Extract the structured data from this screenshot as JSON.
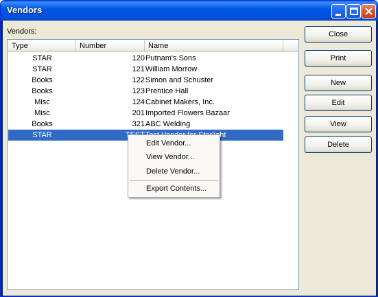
{
  "window": {
    "title": "Vendors",
    "controls": {
      "minimize": "minimize-icon",
      "maximize": "maximize-icon",
      "close": "close-icon"
    }
  },
  "list_label": "Vendors:",
  "columns": [
    "Type",
    "Number",
    "Name"
  ],
  "rows": [
    {
      "type": "STAR",
      "number": "120",
      "name": "Putnam's Sons"
    },
    {
      "type": "STAR",
      "number": "121",
      "name": "William Morrow"
    },
    {
      "type": "Books",
      "number": "122",
      "name": "Simon and Schuster"
    },
    {
      "type": "Books",
      "number": "123",
      "name": "Prentice Hall"
    },
    {
      "type": "Misc",
      "number": "124",
      "name": "Cabinet Makers, Inc."
    },
    {
      "type": "Misc",
      "number": "201",
      "name": "Imported Flowers Bazaar"
    },
    {
      "type": "Books",
      "number": "321",
      "name": "ABC Welding"
    },
    {
      "type": "STAR",
      "number": "TEST",
      "name": "Test Vendor for Starlight",
      "selected": true
    }
  ],
  "buttons": {
    "close": "Close",
    "print": "Print",
    "new": "New",
    "edit": "Edit",
    "view": "View",
    "delete": "Delete"
  },
  "context_menu": {
    "items": [
      "Edit Vendor...",
      "View Vendor...",
      "Delete Vendor...",
      "Export Contents..."
    ]
  },
  "colors": {
    "selection": "#316ac5",
    "titlebar": "#0054e3",
    "dialog_face": "#ece9d8"
  }
}
